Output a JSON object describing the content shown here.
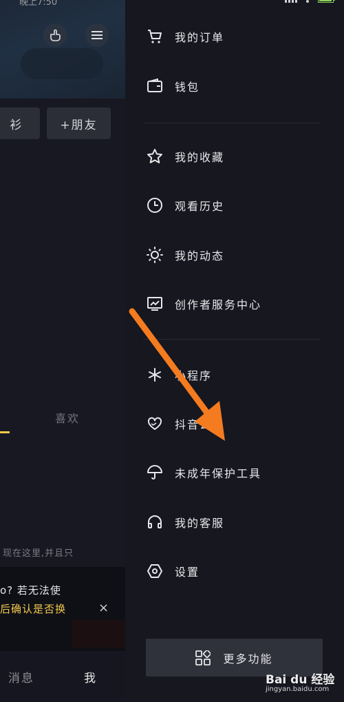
{
  "left_panel": {
    "status_time": "晚上7:50",
    "add_friend_label": "+朋友",
    "partial_button_label": "衫",
    "likes_tab_label": "喜欢",
    "intro_text": "现在这里,并且只",
    "notice_line1": "o? 若无法使",
    "notice_line2": "后确认是否换",
    "notice_close": "×",
    "nav_messages": "消息",
    "nav_me": "我"
  },
  "drawer": {
    "menu_items": [
      {
        "label": "我的订单",
        "icon": "cart-icon"
      },
      {
        "label": "钱包",
        "icon": "wallet-icon"
      },
      {
        "label": "我的收藏",
        "icon": "star-icon"
      },
      {
        "label": "观看历史",
        "icon": "clock-icon"
      },
      {
        "label": "我的动态",
        "icon": "sun-icon"
      },
      {
        "label": "创作者服务中心",
        "icon": "chart-monitor-icon"
      },
      {
        "label": "小程序",
        "icon": "asterisk-icon"
      },
      {
        "label": "抖音公益",
        "icon": "heart-hand-icon"
      },
      {
        "label": "未成年保护工具",
        "icon": "umbrella-icon"
      },
      {
        "label": "我的客服",
        "icon": "headset-icon"
      },
      {
        "label": "设置",
        "icon": "hexagon-settings-icon"
      }
    ],
    "more_label": "更多功能"
  },
  "watermark": {
    "brand": "Bai du 经验",
    "url": "jingyan.baidu.com"
  },
  "colors": {
    "arrow": "#f47b20",
    "accent_yellow": "#f2c94c",
    "drawer_bg": "#16171f"
  }
}
